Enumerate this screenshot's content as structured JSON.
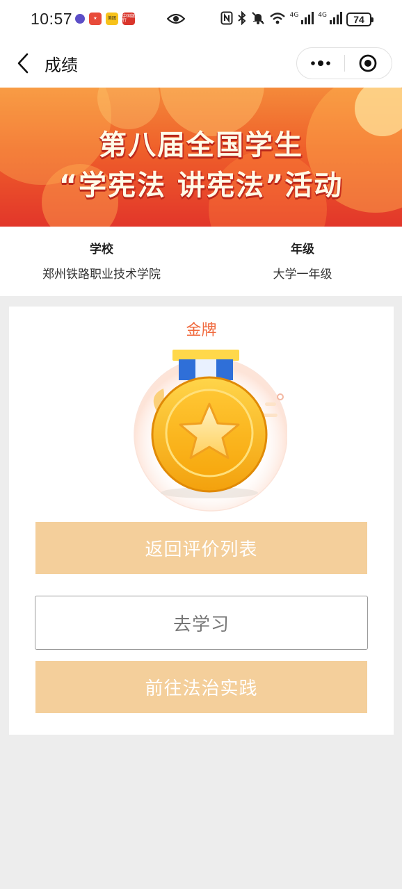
{
  "status_bar": {
    "time": "10:57",
    "battery": "74",
    "apps": [
      "美团",
      "中国银行"
    ]
  },
  "title_bar": {
    "title": "成绩"
  },
  "banner": {
    "line1": "第八届全国学生",
    "line2": "“学宪法  讲宪法”活动"
  },
  "info": {
    "school_label": "学校",
    "school_value": "郑州铁路职业技术学院",
    "grade_label": "年级",
    "grade_value": "大学一年级"
  },
  "result": {
    "medal_title": "金牌",
    "medal_icon": "gold-medal-star-icon"
  },
  "buttons": {
    "back_to_list": "返回评价列表",
    "go_study": "去学习",
    "go_practice": "前往法治实践"
  },
  "colors": {
    "accent_button": "#f4cf9b",
    "medal_title": "#f06a3e",
    "page_background": "#ededed"
  }
}
